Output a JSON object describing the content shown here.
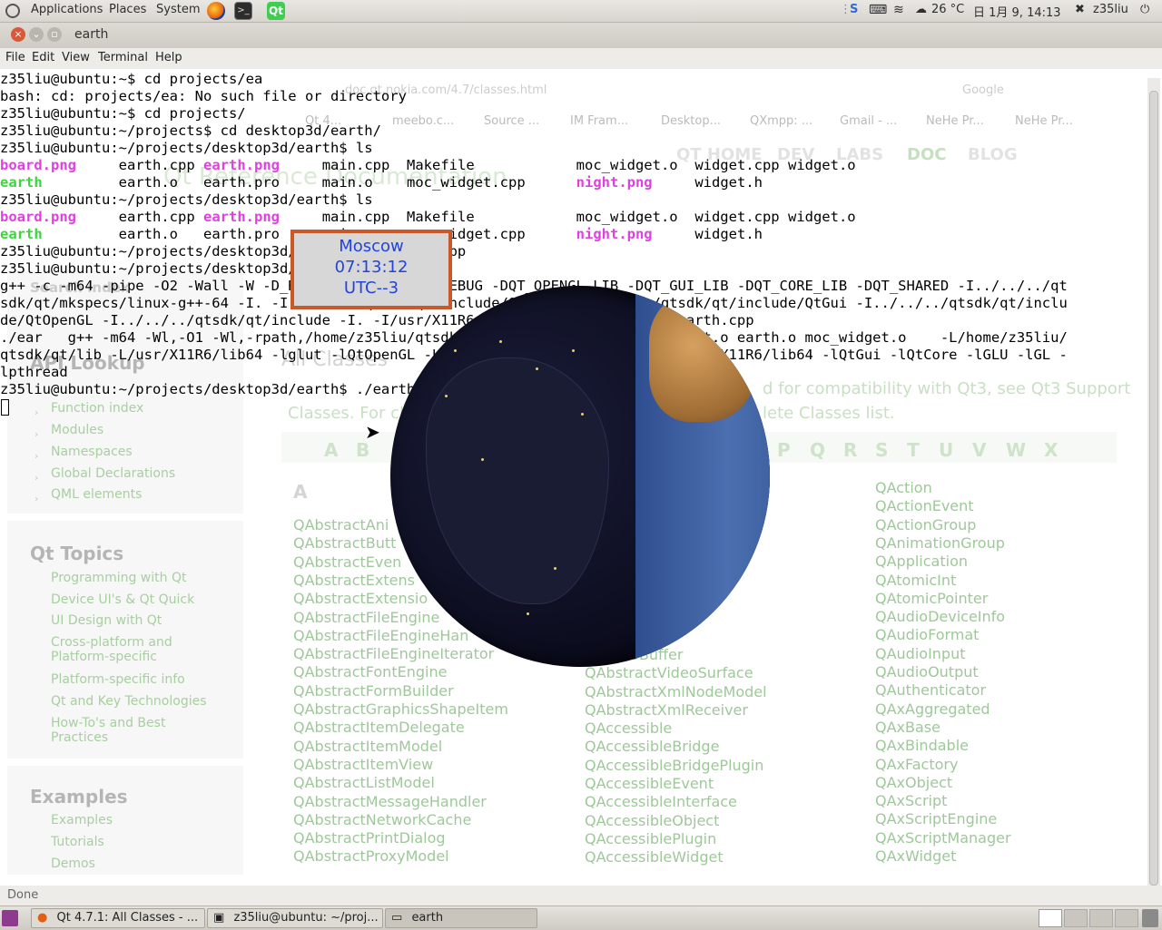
{
  "top_panel": {
    "menus": [
      "Applications",
      "Places",
      "System"
    ],
    "weather": "26 °C",
    "datetime": "日  1月  9, 14:13",
    "user": "z35liu"
  },
  "window": {
    "title": "earth",
    "menu": [
      "File",
      "Edit",
      "View",
      "Terminal",
      "Help"
    ]
  },
  "terminal": {
    "lines": [
      "z35liu@ubuntu:~$ cd projects/ea",
      "bash: cd: projects/ea: No such file or directory",
      "z35liu@ubuntu:~$ cd projects/",
      "z35liu@ubuntu:~/projects$ cd desktop3d/earth/",
      "z35liu@ubuntu:~/projects/desktop3d/earth$ ls",
      "LS1",
      "LS2",
      "z35liu@ubuntu:~/projects/desktop3d/earth$ ls",
      "LS1",
      "LS2",
      "z35liu@ubuntu:~/projects/desktop3d/earth$ vim earth.cpp",
      "z35liu@ubuntu:~/projects/desktop3d/earth$ make",
      "g++ -c -m64 -pipe -O2 -Wall -W -D_REENTRANT -DQT_NO_DEBUG -DQT_OPENGL_LIB -DQT_GUI_LIB -DQT_CORE_LIB -DQT_SHARED -I../../../qt",
      "sdk/qt/mkspecs/linux-g++-64 -I. -I../../../qtsdk/qt/include/QtCore -I../../../qtsdk/qt/include/QtGui -I../../../qtsdk/qt/inclu",
      "de/QtOpenGL -I../../../qtsdk/qt/include -I. -I/usr/X11R6/include -I. -o earth.o earth.cpp",
      "./ear   g++ -m64 -Wl,-O1 -Wl,-rpath,/home/z35liu/qtsdk/qt/lib -o earth main.o widget.o earth.o moc_widget.o    -L/home/z35liu/",
      "qtsdk/qt/lib -L/usr/X11R6/lib64 -lglut -lQtOpenGL -L/home/z35liu/qtsdk/qt/lib -L/usr/X11R6/lib64 -lQtGui -lQtCore -lGLU -lGL -",
      "lpthread",
      "z35liu@ubuntu:~/projects/desktop3d/earth$ ./earth"
    ],
    "ls_row1": [
      {
        "text": "board.png",
        "color": "mag"
      },
      {
        "text": "earth.cpp",
        "color": ""
      },
      {
        "text": "earth.png",
        "color": "mag"
      },
      {
        "text": "main.cpp",
        "color": ""
      },
      {
        "text": "Makefile",
        "color": ""
      },
      {
        "text": "moc_widget.o",
        "color": ""
      },
      {
        "text": "widget.cpp",
        "color": ""
      },
      {
        "text": "widget.o",
        "color": ""
      }
    ],
    "ls_row2": [
      {
        "text": "earth",
        "color": "grn"
      },
      {
        "text": "earth.o",
        "color": ""
      },
      {
        "text": "earth.pro",
        "color": ""
      },
      {
        "text": "main.o",
        "color": ""
      },
      {
        "text": "moc_widget.cpp",
        "color": ""
      },
      {
        "text": "night.png",
        "color": "mag"
      },
      {
        "text": "widget.h",
        "color": ""
      }
    ]
  },
  "clock_widget": {
    "city": "Moscow",
    "time": "07:13:12",
    "zone": "UTC--3"
  },
  "browser_bg": {
    "url": "doc.qt.nokia.com/4.7/classes.html",
    "search_placeholder": "Google",
    "tabs": [
      "Qt 4...",
      "meebo.c...",
      "Source ...",
      "IM Fram...",
      "Desktop...",
      "QXmpp: ...",
      "Gmail - ...",
      "NeHe Pr...",
      "NeHe Pr..."
    ],
    "nav": [
      "QT HOME",
      "DEV",
      "LABS",
      "DOC",
      "BLOG"
    ],
    "header": "Qt Reference Documentation",
    "search_label": "Search index",
    "api_lookup": "API Lookup",
    "api_links": [
      "Function index",
      "Modules",
      "Namespaces",
      "Global Declarations",
      "QML elements"
    ],
    "topics_head": "Qt Topics",
    "topic_links": [
      "Programming with Qt",
      "Device UI's & Qt Quick",
      "UI Design with Qt",
      "Cross-platform and Platform-specific",
      "Platform-specific info",
      "Qt and Key Technologies",
      "How-To's and Best Practices"
    ],
    "examples_head": "Examples",
    "example_links": [
      "Examples",
      "Tutorials",
      "Demos"
    ],
    "all_classes": "All Classes",
    "intro": "d for compatibility with Qt3, see Qt3 Support",
    "intro2": "Classes. For cl",
    "intro3": "lete Classes list.",
    "letters": [
      "A",
      "B",
      "P",
      "Q",
      "R",
      "S",
      "T",
      "U",
      "V",
      "W",
      "X"
    ],
    "section_letter": "A",
    "col1": [
      "QAbstractAni",
      "QAbstractButt",
      "QAbstractEven",
      "QAbstractExtens",
      "QAbstractExtensio",
      "QAbstractFileEngine",
      "QAbstractFileEngineHan",
      "QAbstractFileEngineIterator",
      "QAbstractFontEngine",
      "QAbstractFormBuilder",
      "QAbstractGraphicsShapeItem",
      "QAbstractItemDelegate",
      "QAbstractItemModel",
      "QAbstractItemView",
      "QAbstractListModel",
      "QAbstractMessageHandler",
      "QAbstractNetworkCache",
      "QAbstractPrintDialog",
      "QAbstractProxyModel"
    ],
    "col2": [
      "umentLayout",
      "ction",
      "Resolver",
      "ctVideoBuffer",
      "QAbstractVideoSurface",
      "QAbstractXmlNodeModel",
      "QAbstractXmlReceiver",
      "QAccessible",
      "QAccessibleBridge",
      "QAccessibleBridgePlugin",
      "QAccessibleEvent",
      "QAccessibleInterface",
      "QAccessibleObject",
      "QAccessiblePlugin",
      "QAccessibleWidget"
    ],
    "col3": [
      "QAction",
      "QActionEvent",
      "QActionGroup",
      "QAnimationGroup",
      "QApplication",
      "QAtomicInt",
      "QAtomicPointer",
      "QAudioDeviceInfo",
      "QAudioFormat",
      "QAudioInput",
      "QAudioOutput",
      "QAuthenticator",
      "QAxAggregated",
      "QAxBase",
      "QAxBindable",
      "QAxFactory",
      "QAxObject",
      "QAxScript",
      "QAxScriptEngine",
      "QAxScriptManager",
      "QAxWidget"
    ],
    "status": "Done"
  },
  "taskbar": {
    "tasks": [
      "Qt 4.7.1: All Classes - ...",
      "z35liu@ubuntu: ~/proj...",
      "earth"
    ]
  }
}
